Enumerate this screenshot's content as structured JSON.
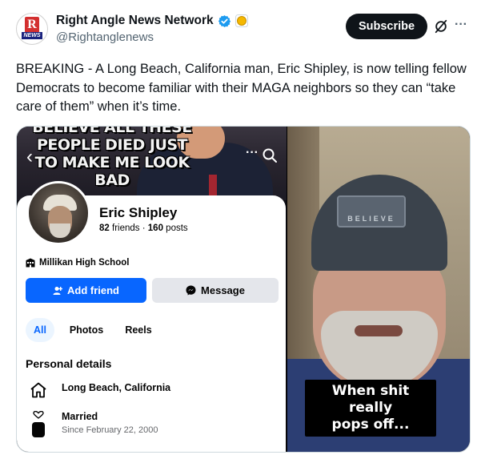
{
  "tweet": {
    "display_name": "Right Angle News Network",
    "handle": "@Rightanglenews",
    "subscribe_label": "Subscribe",
    "avatar_logo_letter": "R",
    "avatar_logo_text": "NEWS",
    "text": "BREAKING - A Long Beach, California man, Eric Shipley, is now telling fellow Democrats to become familiar with their MAGA neighbors so they can “take care of them” when it’s time.",
    "colors": {
      "verified": "#1d9bf0",
      "subscribe_bg": "#0f1419",
      "handle": "#536471"
    }
  },
  "media": {
    "left": {
      "cover_meme_lines": [
        "BELIEVE ALL THESE",
        "PEOPLE DIED JUST",
        "TO MAKE ME LOOK BAD"
      ],
      "profile": {
        "name": "Eric Shipley",
        "friends_count": "82",
        "friends_label": "friends",
        "posts_count": "160",
        "posts_label": "posts",
        "separator": "·",
        "school": "Millikan High School"
      },
      "buttons": {
        "add_friend": "Add friend",
        "message": "Message"
      },
      "tabs": [
        "All",
        "Photos",
        "Reels"
      ],
      "personal_details": {
        "title": "Personal details",
        "location": "Long Beach, California",
        "relationship": "Married",
        "relationship_since": "Since February 22, 2000"
      },
      "colors": {
        "facebook_blue": "#0866ff",
        "message_bg": "#e4e6eb"
      }
    },
    "right": {
      "beanie_patch": "BELIEVE",
      "caption_lines": [
        "When shit really",
        "pops off..."
      ]
    }
  }
}
